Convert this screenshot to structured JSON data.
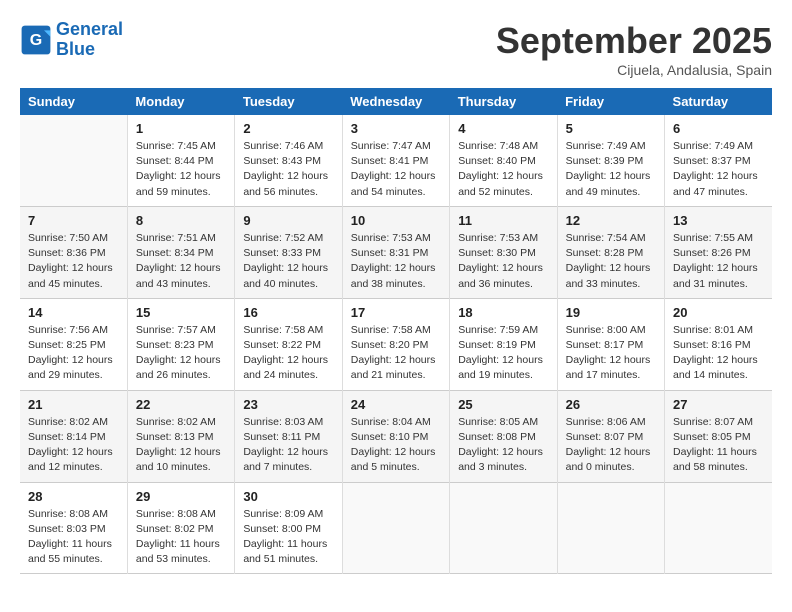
{
  "header": {
    "logo_line1": "General",
    "logo_line2": "Blue",
    "month": "September 2025",
    "location": "Cijuela, Andalusia, Spain"
  },
  "days_of_week": [
    "Sunday",
    "Monday",
    "Tuesday",
    "Wednesday",
    "Thursday",
    "Friday",
    "Saturday"
  ],
  "weeks": [
    [
      {
        "day": "",
        "info": ""
      },
      {
        "day": "1",
        "info": "Sunrise: 7:45 AM\nSunset: 8:44 PM\nDaylight: 12 hours\nand 59 minutes."
      },
      {
        "day": "2",
        "info": "Sunrise: 7:46 AM\nSunset: 8:43 PM\nDaylight: 12 hours\nand 56 minutes."
      },
      {
        "day": "3",
        "info": "Sunrise: 7:47 AM\nSunset: 8:41 PM\nDaylight: 12 hours\nand 54 minutes."
      },
      {
        "day": "4",
        "info": "Sunrise: 7:48 AM\nSunset: 8:40 PM\nDaylight: 12 hours\nand 52 minutes."
      },
      {
        "day": "5",
        "info": "Sunrise: 7:49 AM\nSunset: 8:39 PM\nDaylight: 12 hours\nand 49 minutes."
      },
      {
        "day": "6",
        "info": "Sunrise: 7:49 AM\nSunset: 8:37 PM\nDaylight: 12 hours\nand 47 minutes."
      }
    ],
    [
      {
        "day": "7",
        "info": "Sunrise: 7:50 AM\nSunset: 8:36 PM\nDaylight: 12 hours\nand 45 minutes."
      },
      {
        "day": "8",
        "info": "Sunrise: 7:51 AM\nSunset: 8:34 PM\nDaylight: 12 hours\nand 43 minutes."
      },
      {
        "day": "9",
        "info": "Sunrise: 7:52 AM\nSunset: 8:33 PM\nDaylight: 12 hours\nand 40 minutes."
      },
      {
        "day": "10",
        "info": "Sunrise: 7:53 AM\nSunset: 8:31 PM\nDaylight: 12 hours\nand 38 minutes."
      },
      {
        "day": "11",
        "info": "Sunrise: 7:53 AM\nSunset: 8:30 PM\nDaylight: 12 hours\nand 36 minutes."
      },
      {
        "day": "12",
        "info": "Sunrise: 7:54 AM\nSunset: 8:28 PM\nDaylight: 12 hours\nand 33 minutes."
      },
      {
        "day": "13",
        "info": "Sunrise: 7:55 AM\nSunset: 8:26 PM\nDaylight: 12 hours\nand 31 minutes."
      }
    ],
    [
      {
        "day": "14",
        "info": "Sunrise: 7:56 AM\nSunset: 8:25 PM\nDaylight: 12 hours\nand 29 minutes."
      },
      {
        "day": "15",
        "info": "Sunrise: 7:57 AM\nSunset: 8:23 PM\nDaylight: 12 hours\nand 26 minutes."
      },
      {
        "day": "16",
        "info": "Sunrise: 7:58 AM\nSunset: 8:22 PM\nDaylight: 12 hours\nand 24 minutes."
      },
      {
        "day": "17",
        "info": "Sunrise: 7:58 AM\nSunset: 8:20 PM\nDaylight: 12 hours\nand 21 minutes."
      },
      {
        "day": "18",
        "info": "Sunrise: 7:59 AM\nSunset: 8:19 PM\nDaylight: 12 hours\nand 19 minutes."
      },
      {
        "day": "19",
        "info": "Sunrise: 8:00 AM\nSunset: 8:17 PM\nDaylight: 12 hours\nand 17 minutes."
      },
      {
        "day": "20",
        "info": "Sunrise: 8:01 AM\nSunset: 8:16 PM\nDaylight: 12 hours\nand 14 minutes."
      }
    ],
    [
      {
        "day": "21",
        "info": "Sunrise: 8:02 AM\nSunset: 8:14 PM\nDaylight: 12 hours\nand 12 minutes."
      },
      {
        "day": "22",
        "info": "Sunrise: 8:02 AM\nSunset: 8:13 PM\nDaylight: 12 hours\nand 10 minutes."
      },
      {
        "day": "23",
        "info": "Sunrise: 8:03 AM\nSunset: 8:11 PM\nDaylight: 12 hours\nand 7 minutes."
      },
      {
        "day": "24",
        "info": "Sunrise: 8:04 AM\nSunset: 8:10 PM\nDaylight: 12 hours\nand 5 minutes."
      },
      {
        "day": "25",
        "info": "Sunrise: 8:05 AM\nSunset: 8:08 PM\nDaylight: 12 hours\nand 3 minutes."
      },
      {
        "day": "26",
        "info": "Sunrise: 8:06 AM\nSunset: 8:07 PM\nDaylight: 12 hours\nand 0 minutes."
      },
      {
        "day": "27",
        "info": "Sunrise: 8:07 AM\nSunset: 8:05 PM\nDaylight: 11 hours\nand 58 minutes."
      }
    ],
    [
      {
        "day": "28",
        "info": "Sunrise: 8:08 AM\nSunset: 8:03 PM\nDaylight: 11 hours\nand 55 minutes."
      },
      {
        "day": "29",
        "info": "Sunrise: 8:08 AM\nSunset: 8:02 PM\nDaylight: 11 hours\nand 53 minutes."
      },
      {
        "day": "30",
        "info": "Sunrise: 8:09 AM\nSunset: 8:00 PM\nDaylight: 11 hours\nand 51 minutes."
      },
      {
        "day": "",
        "info": ""
      },
      {
        "day": "",
        "info": ""
      },
      {
        "day": "",
        "info": ""
      },
      {
        "day": "",
        "info": ""
      }
    ]
  ]
}
